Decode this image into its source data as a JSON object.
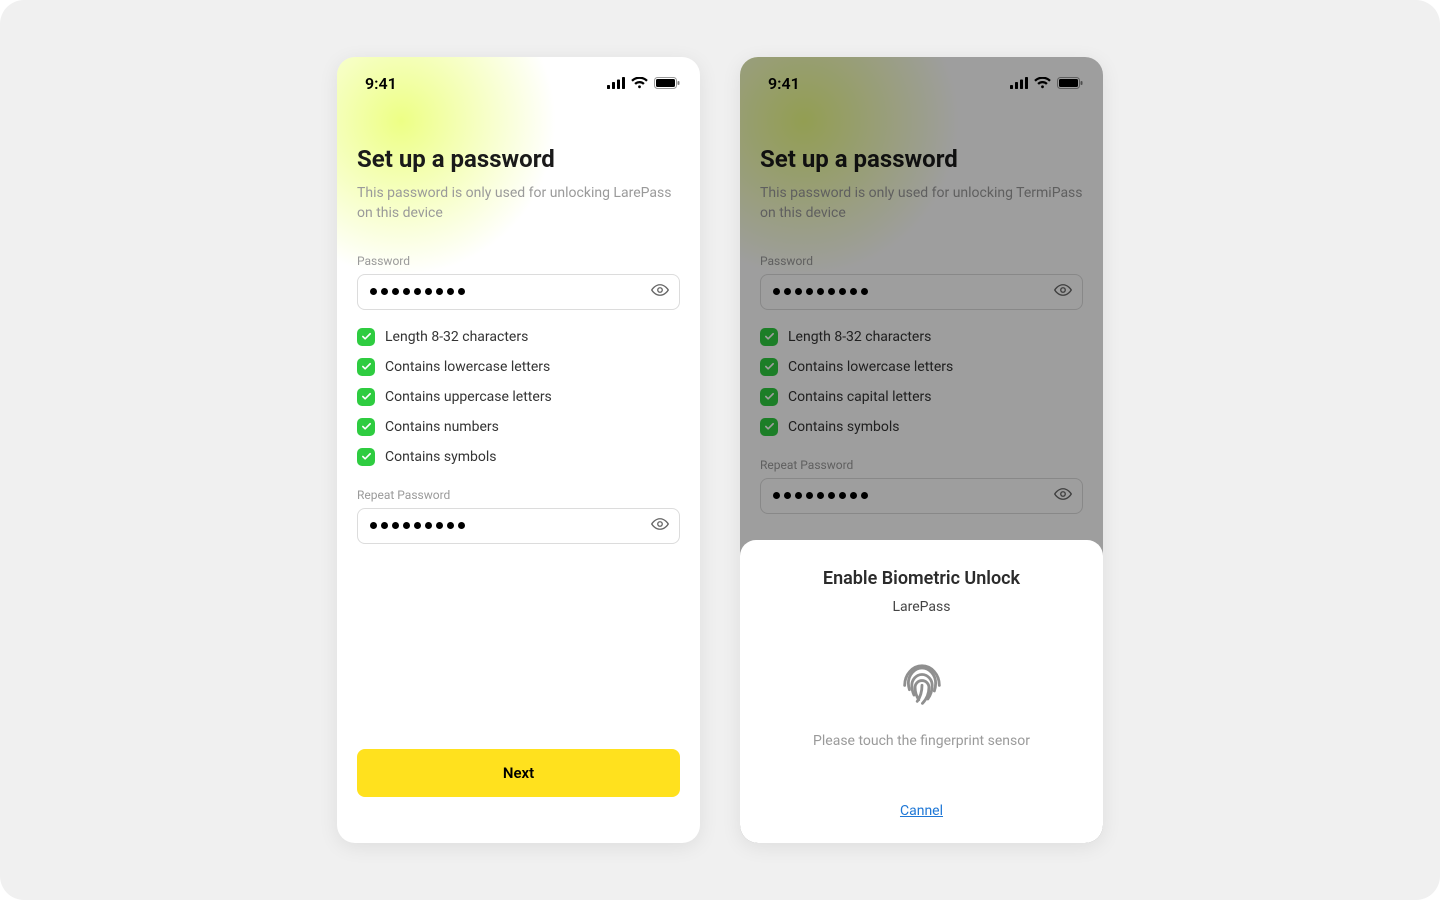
{
  "statusbar": {
    "time": "9:41"
  },
  "left": {
    "title": "Set up a password",
    "subtitle": "This password is only used for unlocking LarePass on this device",
    "password_label": "Password",
    "repeat_label": "Repeat Password",
    "password_dot_count": 9,
    "repeat_dot_count": 9,
    "rules": [
      "Length 8-32 characters",
      "Contains lowercase letters",
      "Contains uppercase letters",
      "Contains numbers",
      "Contains symbols"
    ],
    "next_label": "Next"
  },
  "right": {
    "title": "Set up a password",
    "subtitle": "This password is only used for unlocking TermiPass on this device",
    "password_label": "Password",
    "repeat_label": "Repeat Password",
    "password_dot_count": 9,
    "repeat_dot_count": 9,
    "rules": [
      "Length 8-32 characters",
      "Contains lowercase letters",
      "Contains capital letters",
      "Contains symbols"
    ],
    "sheet": {
      "title": "Enable Biometric Unlock",
      "app": "LarePass",
      "message": "Please touch the fingerprint sensor",
      "cancel": "Cannel"
    }
  }
}
